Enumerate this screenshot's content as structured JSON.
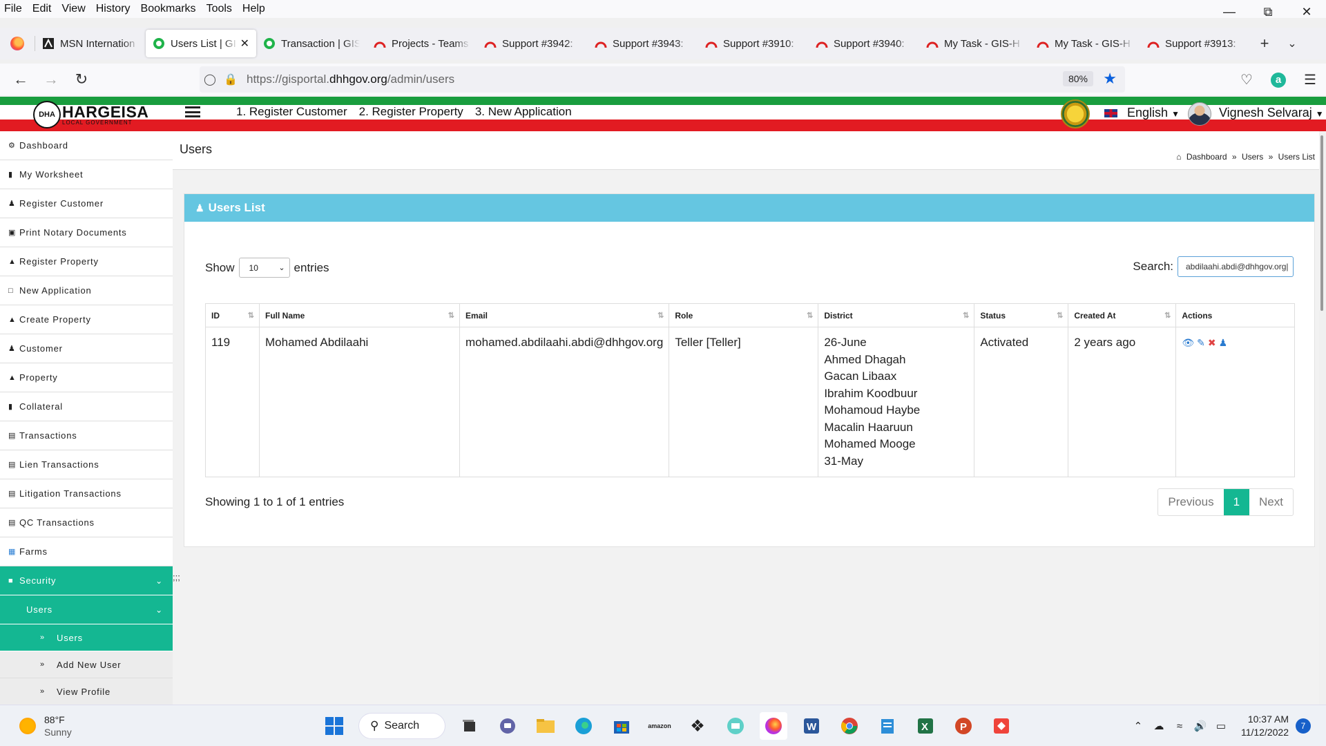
{
  "menubar": {
    "items": [
      "File",
      "Edit",
      "View",
      "History",
      "Bookmarks",
      "Tools",
      "Help"
    ]
  },
  "tabs": [
    {
      "label": "MSN Internation",
      "icon": "msn-icon"
    },
    {
      "label": "Users List | GI",
      "icon": "gis-icon",
      "active": true
    },
    {
      "label": "Transaction | GIS",
      "icon": "gis-icon"
    },
    {
      "label": "Projects - Teams",
      "icon": "redmine-icon"
    },
    {
      "label": "Support #3942:",
      "icon": "redmine-icon"
    },
    {
      "label": "Support #3943:",
      "icon": "redmine-icon"
    },
    {
      "label": "Support #3910:",
      "icon": "redmine-icon"
    },
    {
      "label": "Support #3940:",
      "icon": "redmine-icon"
    },
    {
      "label": "My Task - GIS-H",
      "icon": "redmine-icon"
    },
    {
      "label": "My Task - GIS-H",
      "icon": "redmine-icon"
    },
    {
      "label": "Support #3913:",
      "icon": "redmine-icon"
    }
  ],
  "address": {
    "prefix": "https://gisportal.",
    "domain": "dhhgov.org",
    "path": "/admin/users",
    "zoom": "80%"
  },
  "header": {
    "logo_mark": "DHA",
    "logo_title": "HARGEISA",
    "logo_subtitle": "LOCAL GOVERNMENT",
    "menu": [
      "1. Register Customer",
      "2. Register Property",
      "3. New Application"
    ],
    "language": "English",
    "user": "Vignesh Selvaraj"
  },
  "sidebar": {
    "items": [
      {
        "label": "Dashboard",
        "icon": "dashboard-icon"
      },
      {
        "label": "My Worksheet",
        "icon": "worksheet-icon"
      },
      {
        "label": "Register Customer",
        "icon": "user-icon"
      },
      {
        "label": "Print Notary Documents",
        "icon": "print-icon"
      },
      {
        "label": "Register Property",
        "icon": "home-icon"
      },
      {
        "label": "New Application",
        "icon": "monitor-icon"
      },
      {
        "label": "Create Property",
        "icon": "home-icon"
      },
      {
        "label": "Customer",
        "icon": "user-icon"
      },
      {
        "label": "Property",
        "icon": "home-icon"
      },
      {
        "label": "Collateral",
        "icon": "document-icon"
      },
      {
        "label": "Transactions",
        "icon": "card-icon"
      },
      {
        "label": "Lien Transactions",
        "icon": "card-icon"
      },
      {
        "label": "Litigation Transactions",
        "icon": "card-icon"
      },
      {
        "label": "QC Transactions",
        "icon": "card-icon"
      },
      {
        "label": "Farms",
        "icon": "farm-icon"
      }
    ],
    "security": "Security",
    "users": "Users",
    "sub_items": [
      "Users",
      "Add New User",
      "View Profile"
    ]
  },
  "page": {
    "title": "Users",
    "breadcrumb": [
      "Dashboard",
      "Users",
      "Users List"
    ],
    "panel_title": "Users List",
    "show_label": "Show",
    "entries_label": "entries",
    "page_size": "10",
    "search_label": "Search:",
    "search_value": "abdilaahi.abdi@dhhgov.org",
    "columns": [
      "ID",
      "Full Name",
      "Email",
      "Role",
      "District",
      "Status",
      "Created At",
      "Actions"
    ],
    "rows": [
      {
        "id": "119",
        "full_name": "Mohamed Abdilaahi",
        "email": "mohamed.abdilaahi.abdi@dhhgov.org",
        "role": "Teller [Teller]",
        "districts": [
          "26-June",
          "Ahmed Dhagah",
          "Gacan Libaax",
          "Ibrahim Koodbuur",
          "Mohamoud Haybe",
          "Macalin Haaruun",
          "Mohamed Mooge",
          "31-May"
        ],
        "status": "Activated",
        "created_at": "2 years ago"
      }
    ],
    "footer_info": "Showing 1 to 1 of 1 entries",
    "pager": {
      "previous": "Previous",
      "current": "1",
      "next": "Next"
    },
    "stray_text": ";;;"
  },
  "taskbar": {
    "temp": "88°F",
    "condition": "Sunny",
    "search": "Search",
    "time": "10:37 AM",
    "date": "11/12/2022",
    "notifications": "7"
  },
  "colors": {
    "accent_green": "#14b792",
    "panel_blue": "#65c6e1",
    "flag_green": "#199d3e",
    "flag_red": "#e21b22"
  }
}
